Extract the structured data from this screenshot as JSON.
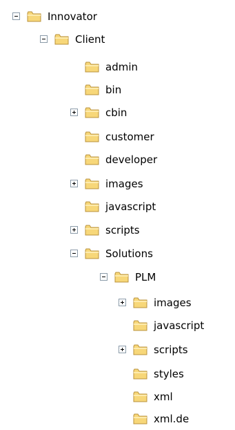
{
  "tree": {
    "nodes": [
      {
        "label": "Innovator",
        "toggle": "minus"
      },
      {
        "label": "Client",
        "toggle": "minus"
      },
      {
        "label": "admin",
        "toggle": "none"
      },
      {
        "label": "bin",
        "toggle": "none"
      },
      {
        "label": "cbin",
        "toggle": "plus"
      },
      {
        "label": "customer",
        "toggle": "none"
      },
      {
        "label": "developer",
        "toggle": "none"
      },
      {
        "label": "images",
        "toggle": "plus"
      },
      {
        "label": "javascript",
        "toggle": "none"
      },
      {
        "label": "scripts",
        "toggle": "plus"
      },
      {
        "label": "Solutions",
        "toggle": "minus"
      },
      {
        "label": "PLM",
        "toggle": "minus"
      },
      {
        "label": "images",
        "toggle": "plus"
      },
      {
        "label": "javascript",
        "toggle": "none"
      },
      {
        "label": "scripts",
        "toggle": "plus"
      },
      {
        "label": "styles",
        "toggle": "none"
      },
      {
        "label": "xml",
        "toggle": "none"
      },
      {
        "label": "xml.de",
        "toggle": "none"
      }
    ]
  },
  "icons": {
    "folder": "folder-icon",
    "expand": "plus-box-icon",
    "collapse": "minus-box-icon"
  },
  "colors": {
    "folder_fill": "#f7d779",
    "folder_stroke": "#b9923b",
    "toggle_border": "#8a9aa8"
  }
}
